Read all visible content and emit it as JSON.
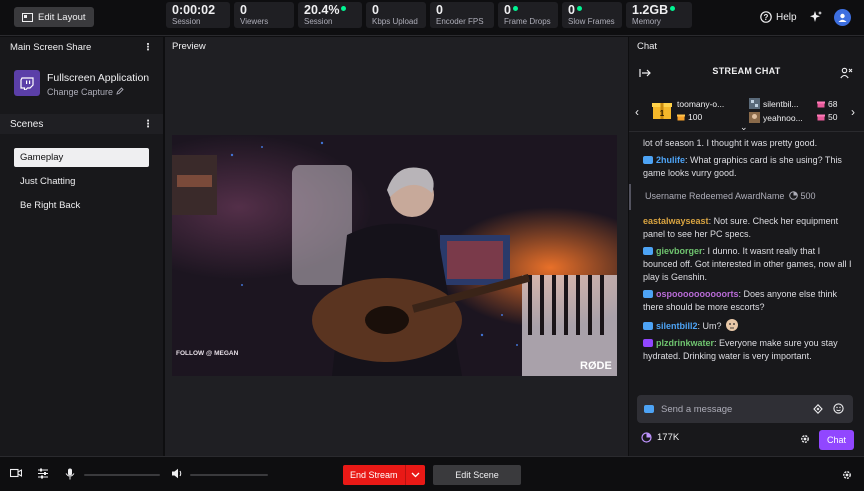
{
  "topbar": {
    "edit_layout": "Edit Layout",
    "stats": [
      {
        "value": "0:00:02",
        "label": "Session",
        "dot": false
      },
      {
        "value": "0",
        "label": "Viewers",
        "dot": false
      },
      {
        "value": "20.4%",
        "label": "Session",
        "dot": true
      },
      {
        "value": "0",
        "label": "Kbps Upload",
        "dot": false
      },
      {
        "value": "0",
        "label": "Encoder FPS",
        "dot": false
      },
      {
        "value": "0",
        "label": "Frame Drops",
        "dot": true
      },
      {
        "value": "0",
        "label": "Slow Frames",
        "dot": true
      },
      {
        "value": "1.2GB",
        "label": "Memory",
        "dot": true
      }
    ],
    "help": "Help"
  },
  "left": {
    "header": "Main Screen Share",
    "capture_name": "Fullscreen Application",
    "capture_change": "Change Capture",
    "scenes_header": "Scenes",
    "scenes": [
      "Gameplay",
      "Just Chatting",
      "Be Right Back"
    ]
  },
  "preview": {
    "title": "Preview",
    "overlay_left": "FOLLOW @ MEGAN",
    "overlay_right": "RØDE"
  },
  "chat": {
    "header": "Chat",
    "title": "STREAM CHAT",
    "hype": [
      {
        "name": "toomany-o...",
        "count": "100"
      },
      {
        "name": "silentbil...",
        "count": "68"
      },
      {
        "name": "yeahnoo...",
        "count": "50"
      }
    ],
    "messages": [
      {
        "user": "",
        "text": "lot of season 1. I thought it was pretty good.",
        "color": "#dedee3",
        "badge": "none"
      },
      {
        "user": "2hulife",
        "text": "What graphics card is she using? This game looks vurry good.",
        "color": "#4da3f5",
        "badge": "blue"
      },
      {
        "user": "eastalwayseast",
        "text": "Not sure. Check her equipment panel to see her PC specs.",
        "color": "#d9a441",
        "badge": "none"
      },
      {
        "user": "gievborger",
        "text": "I dunno. It wasnt really that I bounced off. Got interested in other games, now all I play is Genshin.",
        "color": "#6fc36f",
        "badge": "blue"
      },
      {
        "user": "ospoooooooooorts",
        "text": "Does anyone else think there should be more escorts?",
        "color": "#b86bd6",
        "badge": "blue"
      },
      {
        "user": "silentbill2",
        "text": "Um?",
        "color": "#4da3f5",
        "badge": "blue"
      },
      {
        "user": "plzdrinkwater",
        "text": "Everyone make sure you stay hydrated. Drinking water is very important.",
        "color": "#6fc36f",
        "badge": "purple"
      }
    ],
    "redeem": "Username Redeemed AwardName",
    "redeem_points": "500",
    "input_placeholder": "Send a message",
    "points": "177K",
    "chat_button": "Chat"
  },
  "bottombar": {
    "end_stream": "End Stream",
    "edit_scene": "Edit Scene"
  },
  "colors": {
    "accent": "#9147ff",
    "live": "#e91916",
    "ok": "#00f593"
  }
}
